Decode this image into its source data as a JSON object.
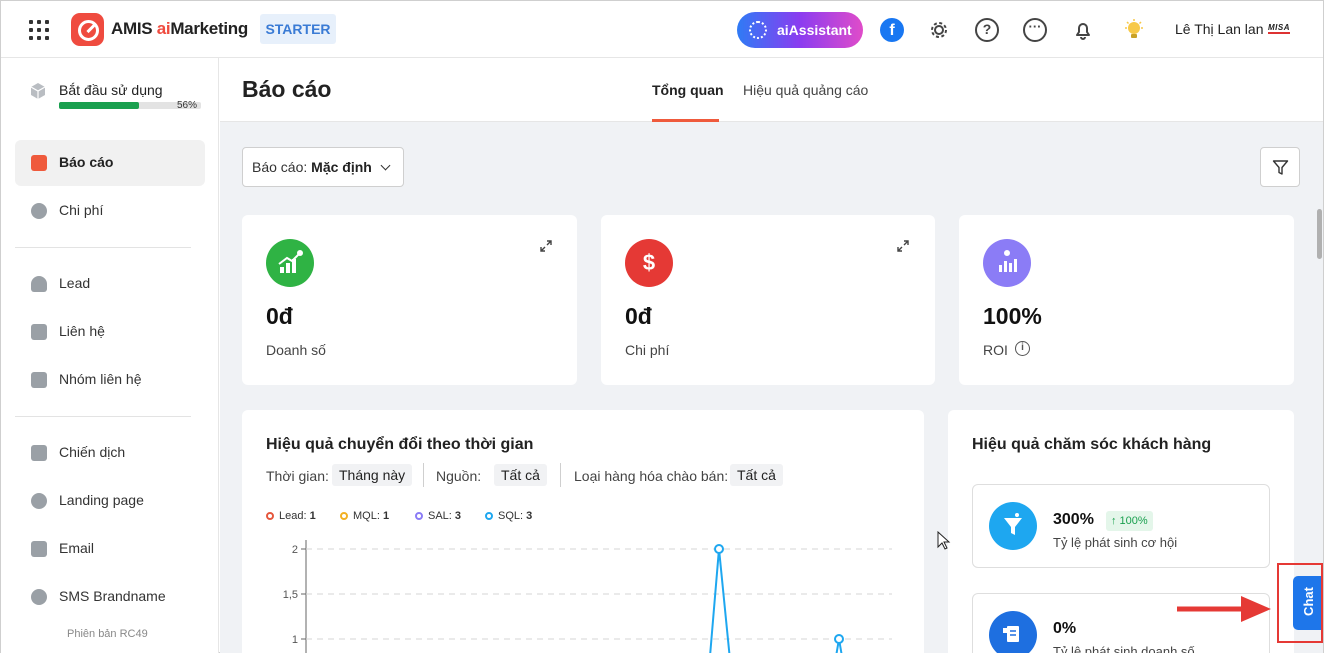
{
  "header": {
    "brand_prefix": "AMIS ",
    "brand_ai": "ai",
    "brand_suffix": "Marketing",
    "plan": "STARTER",
    "ai_assistant": "aiAssistant",
    "user_name": "Lê Thị Lan lan",
    "company_logo": "MISA"
  },
  "sidebar": {
    "onboarding": {
      "label": "Bắt đầu sử dụng",
      "progress_percent": "56%",
      "progress_value": 0.56
    },
    "items": [
      {
        "label": "Báo cáo",
        "icon": "bar-chart-icon",
        "active": true
      },
      {
        "label": "Chi phí",
        "icon": "dollar-icon"
      },
      {
        "label": "Lead",
        "icon": "users-icon"
      },
      {
        "label": "Liên hệ",
        "icon": "contact-card-icon"
      },
      {
        "label": "Nhóm liên hệ",
        "icon": "contact-group-icon"
      },
      {
        "label": "Chiến dịch",
        "icon": "megaphone-icon"
      },
      {
        "label": "Landing page",
        "icon": "globe-icon"
      },
      {
        "label": "Email",
        "icon": "mail-icon"
      },
      {
        "label": "SMS Brandname",
        "icon": "sms-icon"
      }
    ],
    "version": "Phiên bản RC49"
  },
  "page": {
    "title": "Báo cáo",
    "tabs": [
      {
        "label": "Tổng quan",
        "active": true
      },
      {
        "label": "Hiệu quả quảng cáo"
      }
    ],
    "report_select_prefix": "Báo cáo: ",
    "report_select_value": "Mặc định"
  },
  "kpis": [
    {
      "value": "0đ",
      "label": "Doanh số",
      "color": "#2fb344",
      "icon": "growth-chart-icon"
    },
    {
      "value": "0đ",
      "label": "Chi phí",
      "color": "#e53935",
      "icon": "dollar-icon"
    },
    {
      "value": "100%",
      "label": "ROI",
      "color": "#8b7cf6",
      "icon": "roi-chart-icon"
    }
  ],
  "conversion": {
    "title": "Hiệu quả chuyển đổi theo thời gian",
    "filters": [
      {
        "label": "Thời gian:",
        "value": "Tháng này"
      },
      {
        "label": "Nguồn:",
        "value": "Tất cả"
      },
      {
        "label": "Loại hàng hóa chào bán:",
        "value": "Tất cả"
      }
    ]
  },
  "chart_data": {
    "type": "line",
    "title": "Hiệu quả chuyển đổi theo thời gian",
    "xlabel": "",
    "ylabel": "",
    "y_ticks": [
      "2",
      "1,5",
      "1"
    ],
    "ylim": [
      0,
      2
    ],
    "grid": true,
    "legend_placement": "top-left",
    "series": [
      {
        "name": "Lead",
        "total": "1",
        "color": "#e5573d"
      },
      {
        "name": "MQL",
        "total": "1",
        "color": "#f2b124"
      },
      {
        "name": "SAL",
        "total": "3",
        "color": "#8b7cf6"
      },
      {
        "name": "SQL",
        "total": "3",
        "color": "#1ea7f0",
        "visible_points": [
          {
            "y": 2
          },
          {
            "y": 1
          }
        ]
      }
    ]
  },
  "care": {
    "title": "Hiệu quả chăm sóc khách hàng",
    "items": [
      {
        "value": "300%",
        "change": "↑ 100%",
        "label": "Tỷ lệ phát sinh cơ hội",
        "color": "#1ea7f0",
        "icon": "funnel-icon"
      },
      {
        "value": "0%",
        "label": "Tỷ lệ phát sinh doanh số",
        "color": "#1e6fe0",
        "icon": "receipt-icon"
      }
    ]
  },
  "chat": {
    "label": "Chat"
  },
  "colors": {
    "accent": "#ef5a3c",
    "brand": "#ef4b3f",
    "success": "#1aa04f",
    "chat": "#1e76ea"
  }
}
